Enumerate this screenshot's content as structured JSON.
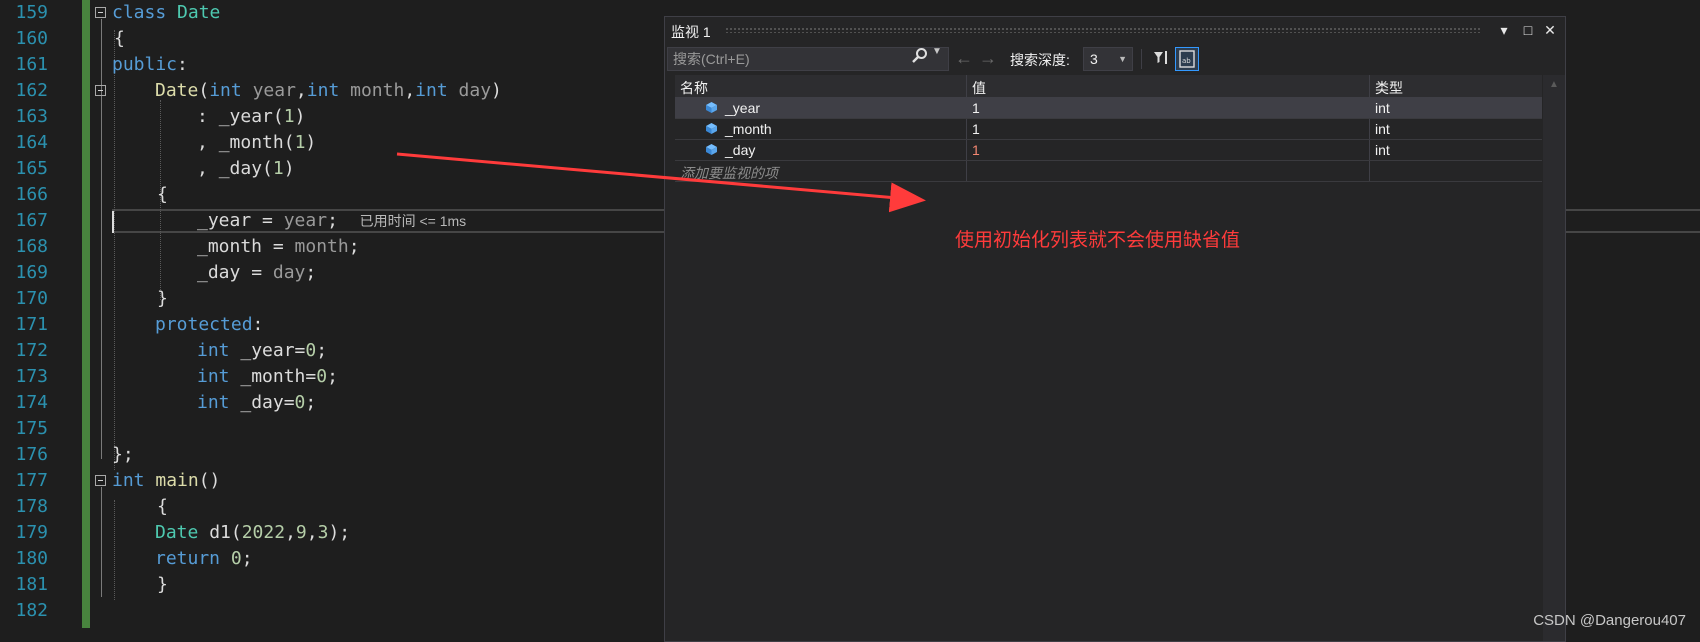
{
  "editor": {
    "line_numbers": [
      "159",
      "160",
      "161",
      "162",
      "163",
      "164",
      "165",
      "166",
      "167",
      "168",
      "169",
      "170",
      "171",
      "172",
      "173",
      "174",
      "175",
      "176",
      "177",
      "178",
      "179",
      "180",
      "181",
      "182"
    ],
    "lines": {
      "l159": {
        "kw": "class",
        "name": "Date"
      },
      "l160": {
        "text": "{"
      },
      "l161": {
        "kw": "public",
        "punct": ":"
      },
      "l162": {
        "fn": "Date",
        "open": "(",
        "t1": "int",
        "p1": "year",
        "c1": ",",
        "t2": "int",
        "p2": "month",
        "c2": ",",
        "t3": "int",
        "p3": "day",
        "close": ")"
      },
      "l163": {
        "pre": ": ",
        "member": "_year",
        "open": "(",
        "num": "1",
        "close": ")"
      },
      "l164": {
        "pre": ", ",
        "member": "_month",
        "open": "(",
        "num": "1",
        "close": ")"
      },
      "l165": {
        "pre": ", ",
        "member": "_day",
        "open": "(",
        "num": "1",
        "close": ")"
      },
      "l166": {
        "text": "{"
      },
      "l167": {
        "member": "_year",
        "op": " = ",
        "param": "year",
        "semi": ";",
        "perf": "已用时间 <= 1ms"
      },
      "l168": {
        "member": "_month",
        "op": " = ",
        "param": "month",
        "semi": ";"
      },
      "l169": {
        "member": "_day",
        "op": " = ",
        "param": "day",
        "semi": ";"
      },
      "l170": {
        "text": "}"
      },
      "l171": {
        "kw": "protected",
        "punct": ":"
      },
      "l172": {
        "kw": "int",
        "rest_a": " _year=",
        "num": "0",
        "semi": ";"
      },
      "l173": {
        "kw": "int",
        "rest_a": " _month=",
        "num": "0",
        "semi": ";"
      },
      "l174": {
        "kw": "int",
        "rest_a": " _day=",
        "num": "0",
        "semi": ";"
      },
      "l176": {
        "text": "};"
      },
      "l177": {
        "kw": "int",
        "fn": " main",
        "punct": "()"
      },
      "l178": {
        "text": "{"
      },
      "l179": {
        "ty": "Date",
        "rest_a": " d1(",
        "n1": "2022",
        "c1": ",",
        "n2": "9",
        "c2": ",",
        "n3": "3",
        "close": ");"
      },
      "l180": {
        "kw": "return",
        "sp": " ",
        "num": "0",
        "semi": ";"
      },
      "l181": {
        "text": "}"
      }
    }
  },
  "watch": {
    "title": "监视 1",
    "title_buttons": {
      "dropdown": "▾",
      "maximize": "□",
      "close": "✕"
    },
    "search_placeholder": "搜索(Ctrl+E)",
    "search_icon": "search-icon",
    "back_arrow": "←",
    "forward_arrow": "→",
    "depth_label": "搜索深度:",
    "depth_value": "3",
    "columns": {
      "name": "名称",
      "value": "值",
      "type": "类型"
    },
    "rows": [
      {
        "name": "_year",
        "value": "1",
        "type": "int",
        "selected": true,
        "changed": false
      },
      {
        "name": "_month",
        "value": "1",
        "type": "int",
        "selected": false,
        "changed": false
      },
      {
        "name": "_day",
        "value": "1",
        "type": "int",
        "selected": false,
        "changed": true
      }
    ],
    "add_item_placeholder": "添加要监视的项",
    "colors": {
      "changed_value": "#f48771",
      "accent": "#3399ff"
    }
  },
  "annotation": {
    "text": "使用初始化列表就不会使用缺省值",
    "color": "#ff3b3b"
  },
  "watermark": "CSDN @Dangerou407"
}
